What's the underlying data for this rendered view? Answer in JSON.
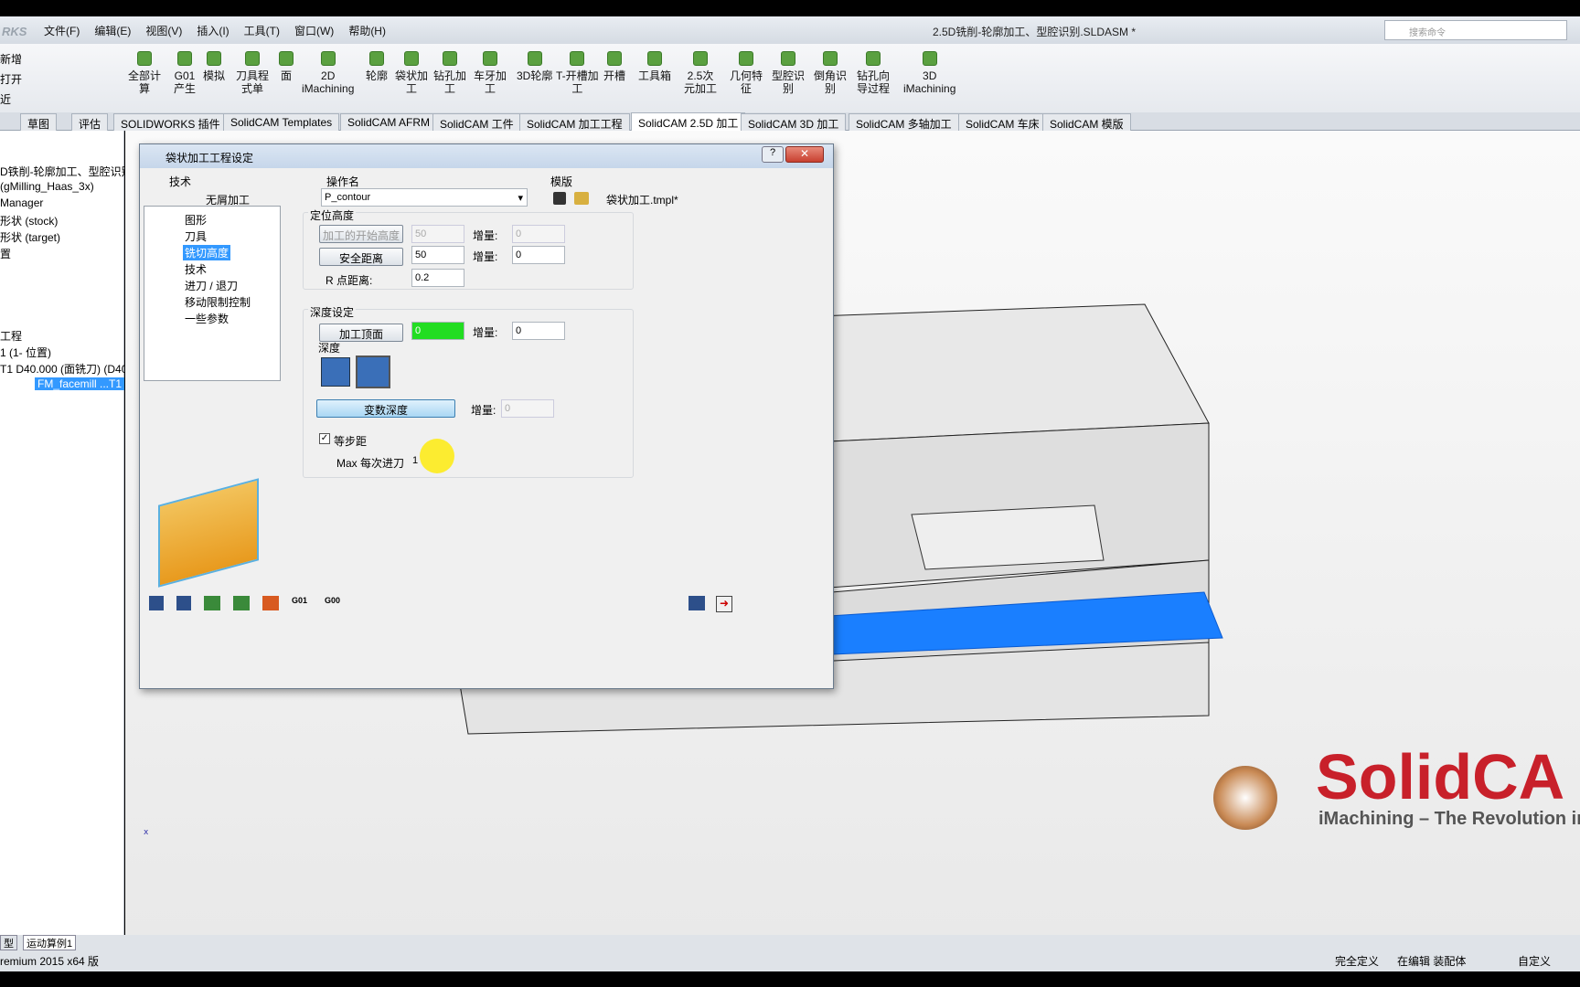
{
  "app": {
    "logo": "RKS",
    "menus": [
      "文件(F)",
      "编辑(E)",
      "视图(V)",
      "插入(I)",
      "工具(T)",
      "窗口(W)",
      "帮助(H)"
    ],
    "title": "2.5D铣削-轮廓加工、型腔识别.SLDASM *",
    "search_placeholder": "搜索命令"
  },
  "left_cmds": [
    "新增",
    "打开",
    "近"
  ],
  "ribbon": [
    {
      "label": "全部计\n算"
    },
    {
      "label": "G01\n产生"
    },
    {
      "label": "模拟"
    },
    {
      "label": "刀具程\n式单"
    },
    {
      "label": "面"
    },
    {
      "label": "2D\niMachining"
    },
    {
      "label": "轮廓"
    },
    {
      "label": "袋状加\n工"
    },
    {
      "label": "钻孔加\n工"
    },
    {
      "label": "车牙加\n工"
    },
    {
      "label": "3D轮廓"
    },
    {
      "label": "T-开槽加\n工"
    },
    {
      "label": "开槽"
    },
    {
      "label": "工具箱"
    },
    {
      "label": "2.5次\n元加工"
    },
    {
      "label": "几何特\n征"
    },
    {
      "label": "型腔识\n别"
    },
    {
      "label": "倒角识\n别"
    },
    {
      "label": "钻孔向\n导过程"
    },
    {
      "label": "3D\niMachining"
    }
  ],
  "tabs": [
    "草图",
    "评估",
    "SOLIDWORKS 插件",
    "SolidCAM Templates",
    "SolidCAM AFRM",
    "SolidCAM 工件",
    "SolidCAM 加工工程",
    "SolidCAM 2.5D 加工",
    "SolidCAM 3D 加工",
    "SolidCAM 多轴加工",
    "SolidCAM 车床",
    "SolidCAM 模版"
  ],
  "tree": [
    "D铁削-轮廓加工、型腔识别",
    "(gMilling_Haas_3x)",
    "Manager",
    "形状 (stock)",
    "形状 (target)",
    "置",
    "工程",
    "1 (1- 位置)",
    "T1  D40.000 (面铣刀) (D40",
    "FM_facemill ...T1"
  ],
  "dialog": {
    "title": "袋状加工工程设定",
    "tech_label": "技术",
    "tech_value": "无屑加工",
    "opname_label": "操作名",
    "opname_value": "P_contour",
    "template_label": "模版",
    "template_value": "袋状加工.tmpl*",
    "nav": [
      "图形",
      "刀具",
      "铣切高度",
      "技术",
      "进刀 / 退刀",
      "移动限制控制",
      "一些参数"
    ],
    "pos_group": "定位高度",
    "start_height": "加工的开始高度",
    "start_height_val": "50",
    "start_inc_label": "增量:",
    "start_inc_val": "0",
    "safe_dist": "安全距离",
    "safe_dist_val": "50",
    "safe_inc_val": "0",
    "r_dist_label": "R 点距离:",
    "r_dist_val": "0.2",
    "depth_group": "深度设定",
    "top_btn": "加工顶面",
    "top_val": "0",
    "top_inc_val": "0",
    "depth_label": "深度",
    "var_depth": "变数深度",
    "var_inc_val": "0",
    "equal_step": "等步距",
    "max_step_label": "Max 每次进刀",
    "max_step_val": "1"
  },
  "status": {
    "tabs": [
      "型",
      "运动算例1"
    ],
    "left": "remium 2015 x64 版",
    "r1": "完全定义",
    "r2": "在编辑 装配体",
    "r3": "自定义"
  },
  "brand": {
    "name": "SolidCA",
    "tagline": "iMachining – The Revolution in"
  }
}
